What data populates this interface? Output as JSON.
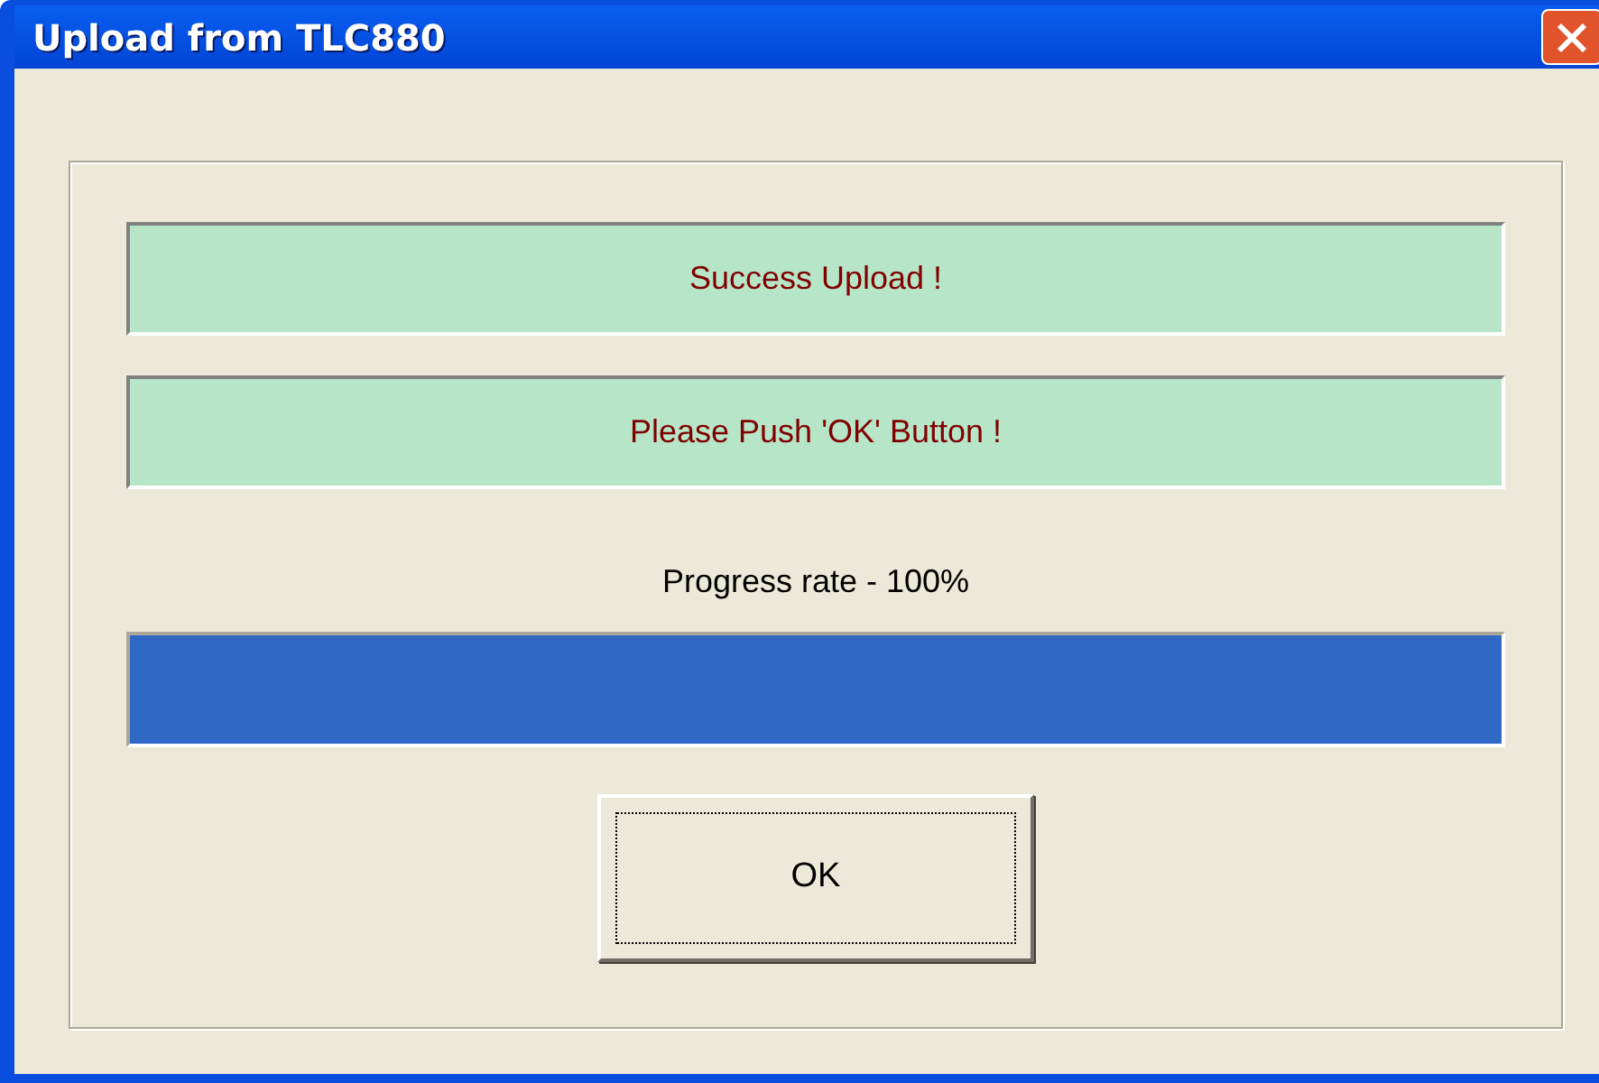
{
  "window": {
    "title": "Upload from TLC880"
  },
  "messages": [
    {
      "text": "Success Upload !"
    },
    {
      "text": "Please Push 'OK' Button !"
    }
  ],
  "progress": {
    "label": "Progress rate - 100%",
    "level": 1
  },
  "buttons": [
    {
      "label": "OK",
      "focused": true
    }
  ]
}
